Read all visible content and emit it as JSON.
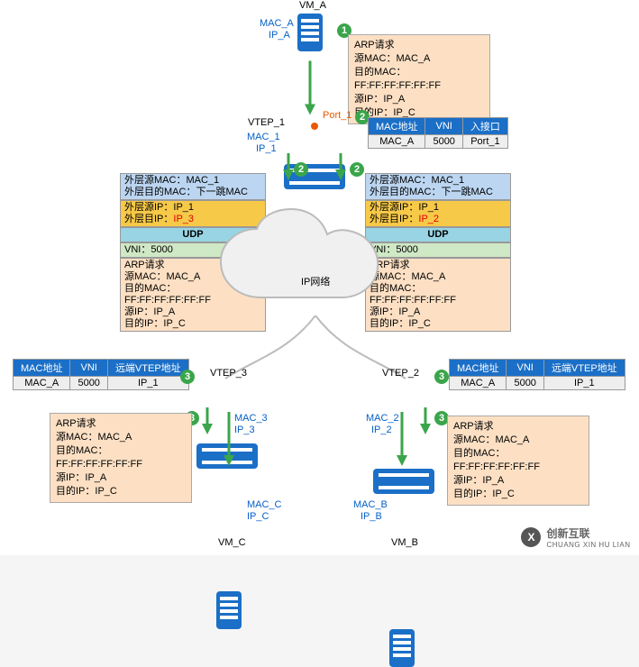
{
  "vm_a": {
    "label": "VM_A",
    "mac": "MAC_A",
    "ip": "IP_A"
  },
  "vm_b": {
    "label": "VM_B",
    "mac": "MAC_B",
    "ip": "IP_B"
  },
  "vm_c": {
    "label": "VM_C",
    "mac": "MAC_C",
    "ip": "IP_C"
  },
  "vtep1": {
    "label": "VTEP_1",
    "mac": "MAC_1",
    "ip": "IP_1",
    "port": "Port_1"
  },
  "vtep2": {
    "label": "VTEP_2",
    "mac": "MAC_2",
    "ip": "IP_2"
  },
  "vtep3": {
    "label": "VTEP_3",
    "mac": "MAC_3",
    "ip": "IP_3"
  },
  "cloud": "IP网络",
  "steps": {
    "s1": "1",
    "s2": "2",
    "s3": "3"
  },
  "arp1": {
    "l1": "ARP请求",
    "l2": "源MAC：MAC_A",
    "l3": "目的MAC：FF:FF:FF:FF:FF:FF",
    "l4": "源IP：IP_A",
    "l5": "目的IP：IP_C"
  },
  "pkt_left": {
    "osm": "外层源MAC：MAC_1",
    "odm": "外层目的MAC：下一跳MAC",
    "osi": "外层源IP：IP_1",
    "odi_lab": "外层目IP：",
    "odi": "IP_3",
    "udp": "UDP",
    "vni": "VNI：5000",
    "arp1": "ARP请求",
    "arp2": "源MAC：MAC_A",
    "arp3": "目的MAC：FF:FF:FF:FF:FF:FF",
    "arp4": "源IP：IP_A",
    "arp5": "目的IP：IP_C"
  },
  "pkt_right": {
    "osm": "外层源MAC：MAC_1",
    "odm": "外层目的MAC：下一跳MAC",
    "osi": "外层源IP：IP_1",
    "odi_lab": "外层目IP：",
    "odi": "IP_2",
    "udp": "UDP",
    "vni": "VNI：5000",
    "arp1": "ARP请求",
    "arp2": "源MAC：MAC_A",
    "arp3": "目的MAC：FF:FF:FF:FF:FF:FF",
    "arp4": "源IP：IP_A",
    "arp5": "目的IP：IP_C"
  },
  "arp_bl": {
    "l1": "ARP请求",
    "l2": "源MAC：MAC_A",
    "l3": "目的MAC：FF:FF:FF:FF:FF:FF",
    "l4": "源IP：IP_A",
    "l5": "目的IP：IP_C"
  },
  "arp_br": {
    "l1": "ARP请求",
    "l2": "源MAC：MAC_A",
    "l3": "目的MAC：FF:FF:FF:FF:FF:FF",
    "l4": "源IP：IP_A",
    "l5": "目的IP：IP_C"
  },
  "mt_top": {
    "h1": "MAC地址",
    "h2": "VNI",
    "h3": "入接口",
    "r1": "MAC_A",
    "r2": "5000",
    "r3": "Port_1"
  },
  "mt_left": {
    "h1": "MAC地址",
    "h2": "VNI",
    "h3": "远端VTEP地址",
    "r1": "MAC_A",
    "r2": "5000",
    "r3": "IP_1"
  },
  "mt_right": {
    "h1": "MAC地址",
    "h2": "VNI",
    "h3": "远端VTEP地址",
    "r1": "MAC_A",
    "r2": "5000",
    "r3": "IP_1"
  },
  "watermark": {
    "brand": "创新互联",
    "sub": "CHUANG XIN HU LIAN"
  }
}
